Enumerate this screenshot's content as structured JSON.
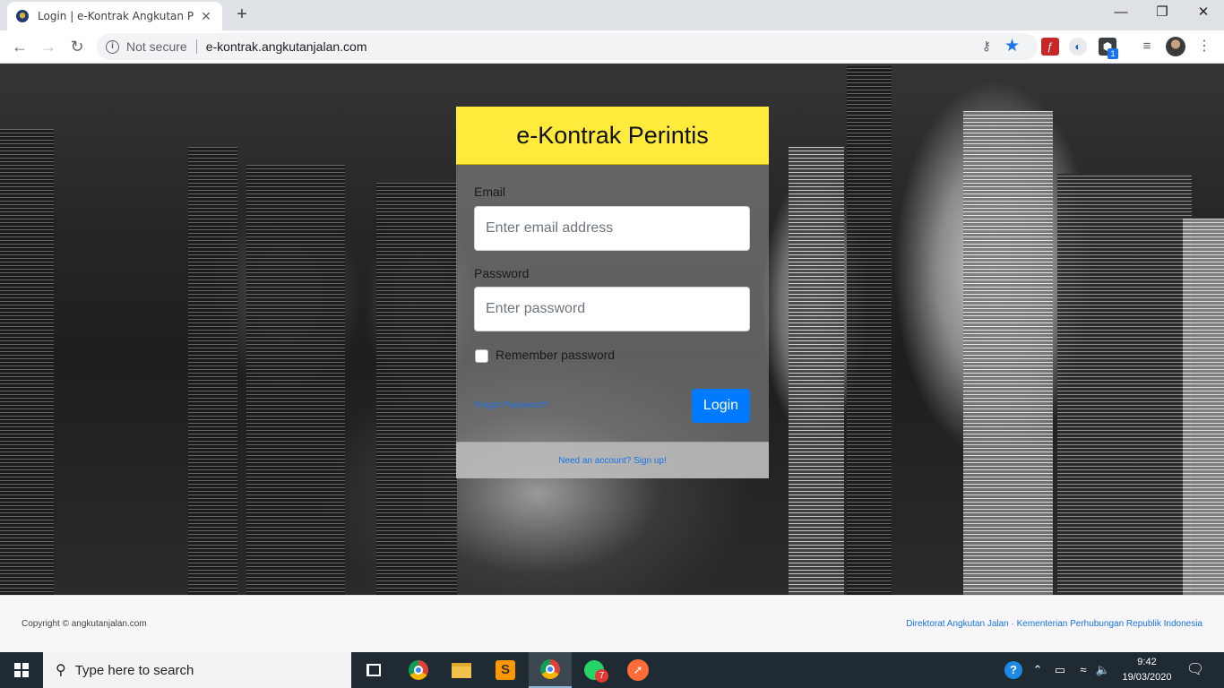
{
  "browser": {
    "tab_title": "Login | e-Kontrak Angkutan Perintis",
    "tab_close": "✕",
    "new_tab": "+",
    "security_label": "Not secure",
    "url": "e-kontrak.angkutanjalan.com",
    "extension_badge": "1",
    "window_controls": {
      "minimize": "—",
      "maximize": "❐",
      "close": "✕"
    }
  },
  "login_card": {
    "title": "e-Kontrak Perintis",
    "email_label": "Email",
    "email_placeholder": "Enter email address",
    "password_label": "Password",
    "password_placeholder": "Enter password",
    "remember_label": "Remember password",
    "forgot_link": "Forgot Password?",
    "login_button": "Login",
    "signup_link": "Need an account? Sign up!"
  },
  "footer": {
    "copyright": "Copyright © angkutanjalan.com",
    "directorate_links": "Direktorat Angkutan Jalan · Kementerian Perhubungan Republik Indonesia"
  },
  "taskbar": {
    "search_placeholder": "Type here to search",
    "whatsapp_badge": "7",
    "time": "9:42",
    "date": "19/03/2020"
  },
  "colors": {
    "header_yellow": "#ffeb3b",
    "primary_blue": "#007bff",
    "link_blue": "#1a73e8"
  }
}
